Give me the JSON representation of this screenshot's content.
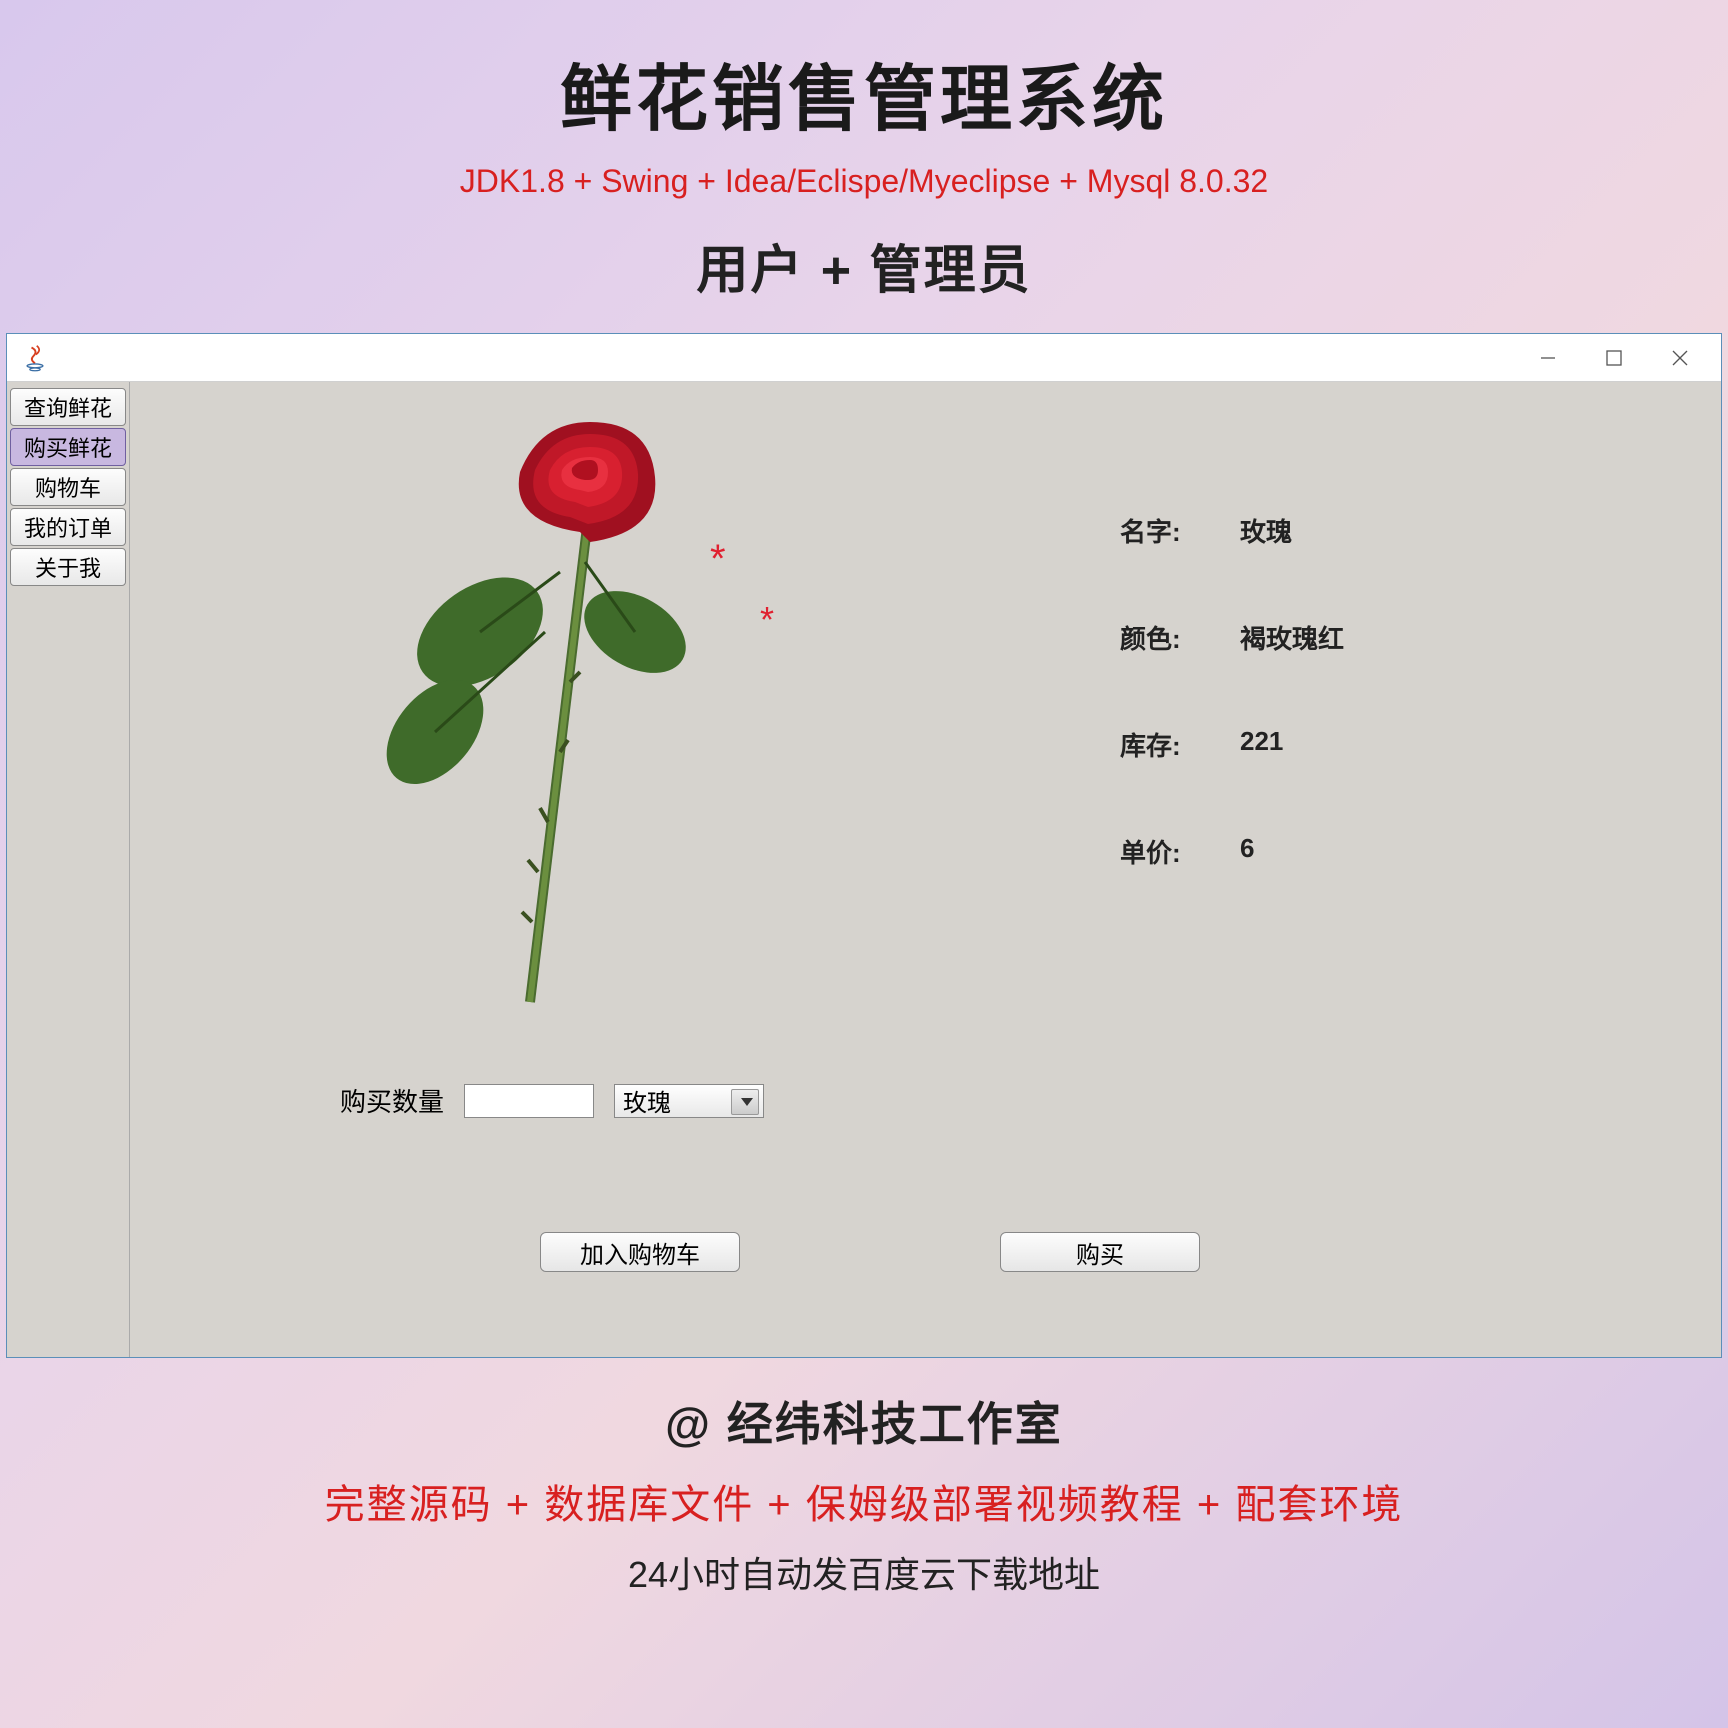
{
  "header": {
    "title": "鲜花销售管理系统",
    "tech": "JDK1.8 + Swing + Idea/Eclispe/Myeclipse + Mysql 8.0.32",
    "roles": "用户 + 管理员"
  },
  "sidebar": {
    "items": [
      {
        "label": "查询鲜花"
      },
      {
        "label": "购买鲜花"
      },
      {
        "label": "购物车"
      },
      {
        "label": "我的订单"
      },
      {
        "label": "关于我"
      }
    ],
    "active_index": 1
  },
  "details": {
    "name_label": "名字:",
    "name_value": "玫瑰",
    "color_label": "颜色:",
    "color_value": "褐玫瑰红",
    "stock_label": "库存:",
    "stock_value": "221",
    "price_label": "单价:",
    "price_value": "6"
  },
  "purchase": {
    "qty_label": "购买数量",
    "qty_value": "",
    "select_value": "玫瑰",
    "add_cart_label": "加入购物车",
    "buy_label": "购买"
  },
  "footer": {
    "studio": "@ 经纬科技工作室",
    "package": "完整源码 + 数据库文件 + 保姆级部署视频教程 + 配套环境",
    "delivery": "24小时自动发百度云下载地址"
  }
}
